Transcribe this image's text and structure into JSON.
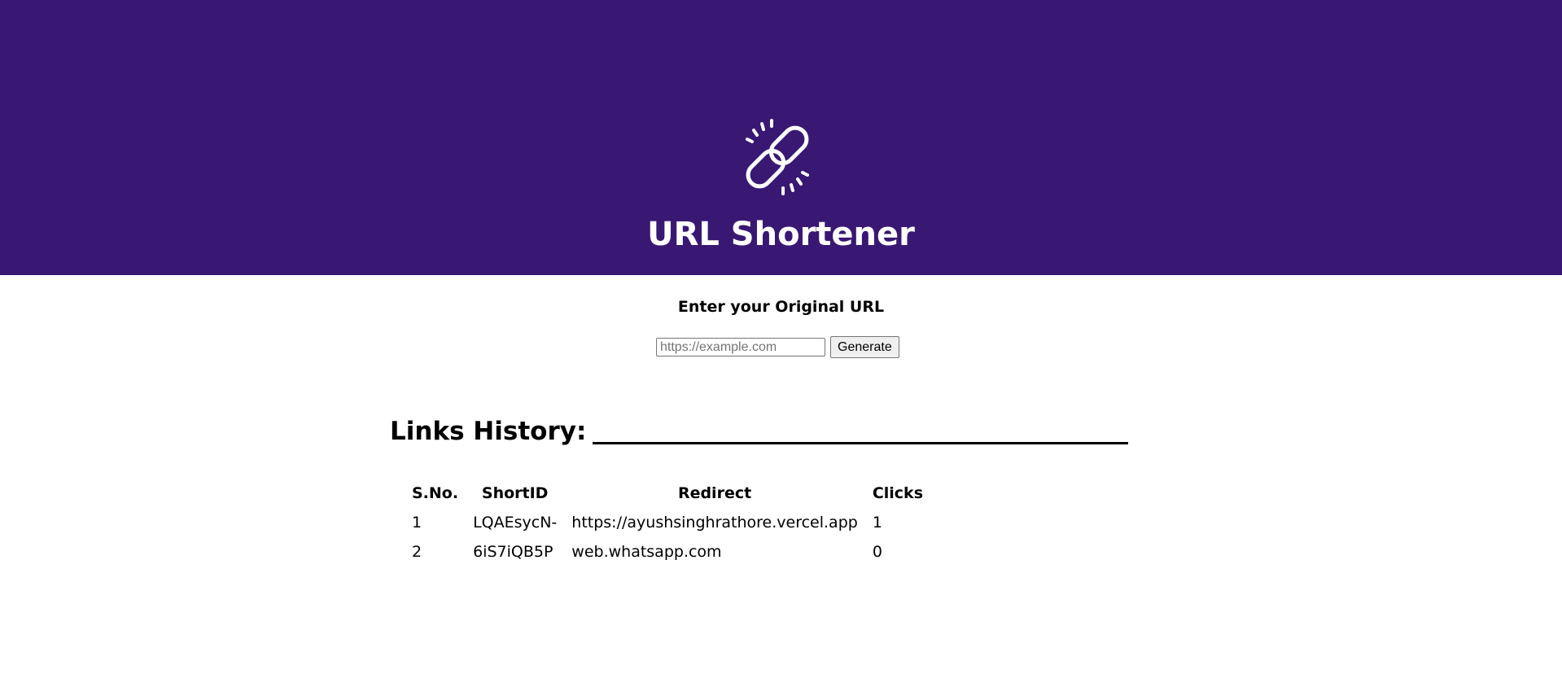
{
  "header": {
    "title": "URL Shortener",
    "logo_icon": "broken-chain-link-icon",
    "background_color": "#391874",
    "text_color": "#ffffff"
  },
  "form": {
    "label": "Enter your Original URL",
    "input_value": "",
    "input_placeholder": "https://example.com",
    "button_label": "Generate"
  },
  "history": {
    "title": "Links History:",
    "columns": [
      "S.No.",
      "ShortID",
      "Redirect",
      "Clicks"
    ],
    "rows": [
      {
        "sno": "1",
        "short_id": "LQAEsycN-",
        "redirect": "https://ayushsinghrathore.vercel.app",
        "clicks": "1"
      },
      {
        "sno": "2",
        "short_id": "6iS7iQB5P",
        "redirect": "web.whatsapp.com",
        "clicks": "0"
      }
    ]
  }
}
